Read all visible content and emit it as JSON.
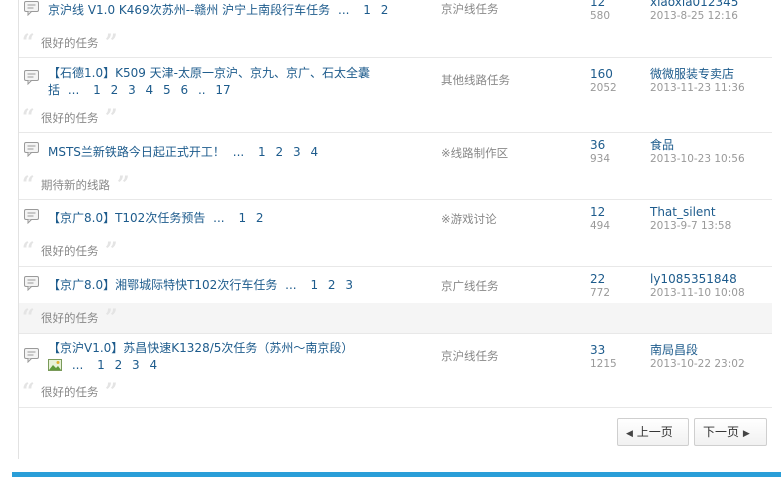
{
  "topics": [
    {
      "title_parts": [
        "京沪线  V1.0 K469次苏州--赣州  沪宁上南段行车任务"
      ],
      "pages": [
        "1",
        "2"
      ],
      "forum": "京沪线任务",
      "replies": "12",
      "views": "580",
      "last_user": "xiaoxia012345",
      "last_time": "2013-8-25 12:16",
      "quote": "很好的任务"
    },
    {
      "title_parts": [
        "【石德1.0】K509 天津-太原一京沪、京九、京广、石太全囊",
        "括"
      ],
      "pages": [
        "1",
        "2",
        "3",
        "4",
        "5",
        "6",
        "..",
        "17"
      ],
      "forum": "其他线路任务",
      "replies": "160",
      "views": "2052",
      "last_user": "微微服装专卖店",
      "last_time": "2013-11-23 11:36",
      "quote": "很好的任务"
    },
    {
      "title_parts": [
        "MSTS兰新铁路今日起正式开工！"
      ],
      "pages": [
        "1",
        "2",
        "3",
        "4"
      ],
      "forum": "※线路制作区",
      "replies": "36",
      "views": "934",
      "last_user": "食品",
      "last_time": "2013-10-23 10:56",
      "quote": "期待新的线路"
    },
    {
      "title_parts": [
        "【京广8.0】T102次任务预告"
      ],
      "pages": [
        "1",
        "2"
      ],
      "forum": "※游戏讨论",
      "replies": "12",
      "views": "494",
      "last_user": "That_silent",
      "last_time": "2013-9-7 13:58",
      "quote": "很好的任务"
    },
    {
      "title_parts": [
        "【京广8.0】湘鄂城际特快T102次行车任务"
      ],
      "pages": [
        "1",
        "2",
        "3"
      ],
      "forum": "京广线任务",
      "replies": "22",
      "views": "772",
      "last_user": "ly1085351848",
      "last_time": "2013-11-10 10:08",
      "quote": "很好的任务"
    },
    {
      "title_parts": [
        "【京沪V1.0】苏昌快速K1328/5次任务（苏州～南京段）"
      ],
      "pages": [
        "1",
        "2",
        "3",
        "4"
      ],
      "forum": "京沪线任务",
      "replies": "33",
      "views": "1215",
      "last_user": "南局昌段",
      "last_time": "2013-10-22 23:02",
      "quote": "很好的任务"
    }
  ],
  "ellipsis": "...",
  "pager": {
    "prev": "上一页",
    "next": "下一页"
  },
  "colors": {
    "link": "#1d5b8c",
    "muted": "#888888",
    "accent_bar": "#2a9ed8"
  },
  "icons": {
    "topic": "speech-bubble-icon",
    "quote": "quote-mark-icon",
    "attachment": "image-attachment-icon",
    "prev": "triangle-left-icon",
    "next": "triangle-right-icon"
  }
}
